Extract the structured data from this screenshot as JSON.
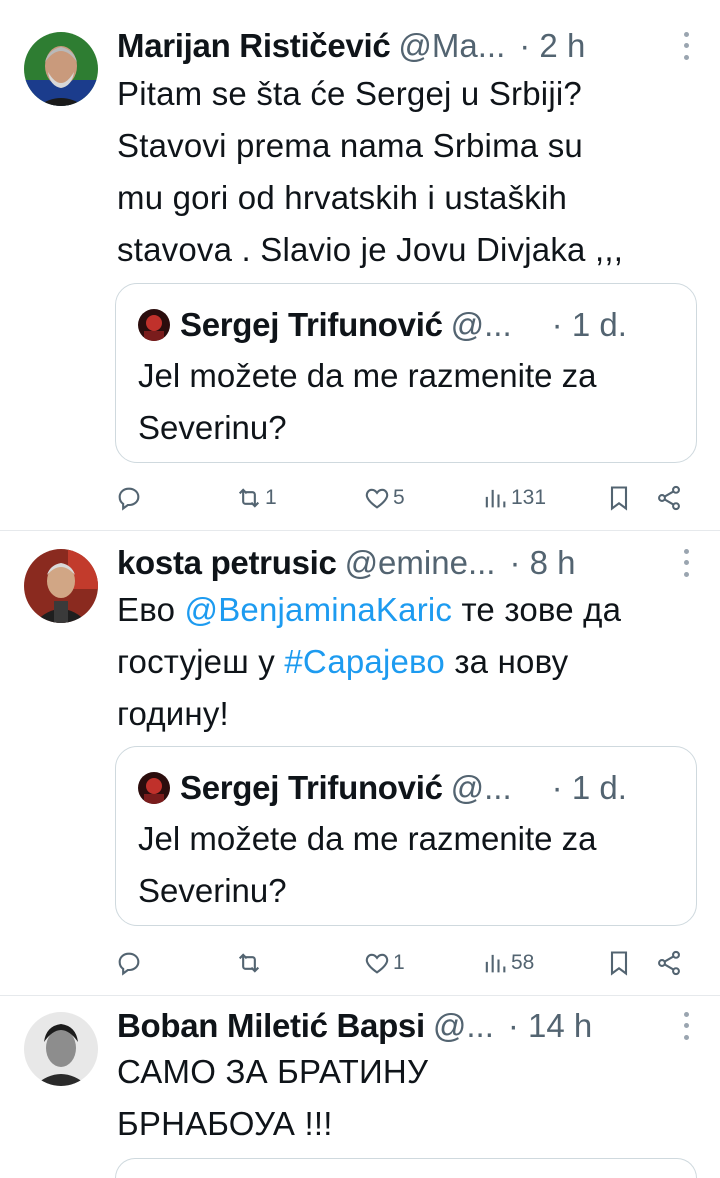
{
  "tweets": [
    {
      "name": "Marijan Rističević",
      "handle": "@Ma...",
      "time": "· 2 h",
      "text_lines": [
        "Pitam se  šta će Sergej u Srbiji?",
        "Stavovi  prema nama  Srbima su",
        "mu gori od hrvatskih  i ustaških",
        "stavova . Slavio je Jovu Divjaka ,,,"
      ],
      "quote": {
        "name": "Sergej Trifunović",
        "handle": "@...",
        "time": "· 1 d.",
        "text_lines": [
          "Jel možete da me razmenite za",
          "Severinu?"
        ]
      },
      "actions": {
        "replies": "",
        "retweets": "1",
        "likes": "5",
        "views": "131"
      }
    },
    {
      "name": "kosta petrusic",
      "handle": "@emine...",
      "time": "· 8 h",
      "text": {
        "l1_a": "Ево ",
        "l1_mention": "@BenjaminaKaric",
        "l1_b": " те зове да",
        "l2_a": "гостујеш у ",
        "l2_hashtag": "#Сарајево",
        "l2_b": " за нову",
        "l3": "годину!"
      },
      "quote": {
        "name": "Sergej Trifunović",
        "handle": "@...",
        "time": "· 1 d.",
        "text_lines": [
          "Jel možete da me razmenite za",
          "Severinu?"
        ]
      },
      "actions": {
        "replies": "",
        "retweets": "",
        "likes": "1",
        "views": "58"
      }
    },
    {
      "name": "Boban Miletić Bapsi",
      "handle": "@...",
      "time": "· 14 h",
      "text_lines": [
        "САМО ЗА БРАТИНУ",
        "БРНАБОУА !!!"
      ]
    }
  ],
  "colors": {
    "link": "#1d9bf0",
    "secondary": "#536471",
    "border": "#cfd9de"
  },
  "icons": [
    "reply-icon",
    "retweet-icon",
    "like-icon",
    "views-icon",
    "bookmark-icon",
    "share-icon",
    "more-icon"
  ]
}
